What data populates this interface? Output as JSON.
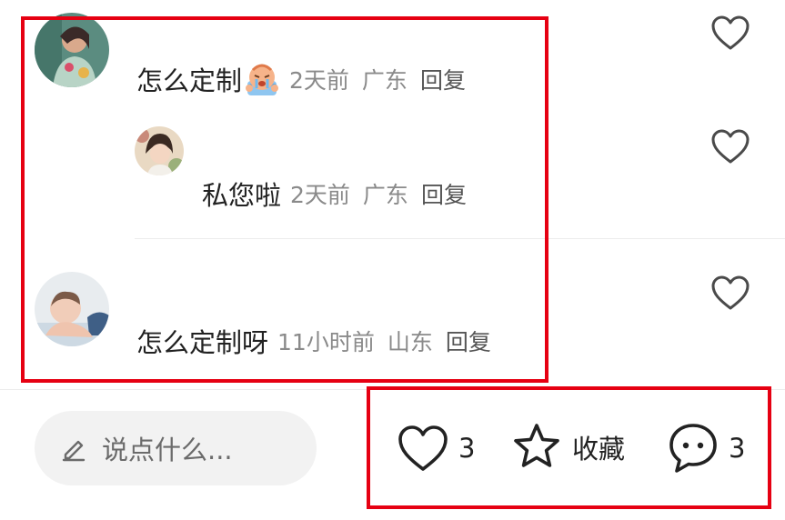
{
  "comments": [
    {
      "text": "怎么定制",
      "emoji": "crying-face-sticker",
      "time": "2天前",
      "location": "广东",
      "reply_label": "回复"
    },
    {
      "text": "私您啦",
      "time": "2天前",
      "location": "广东",
      "reply_label": "回复"
    },
    {
      "text": "怎么定制呀",
      "time": "11小时前",
      "location": "山东",
      "reply_label": "回复"
    }
  ],
  "bottom_bar": {
    "input_placeholder": "说点什么...",
    "like_count": "3",
    "collect_label": "收藏",
    "comment_count": "3"
  },
  "colors": {
    "highlight_border": "#e60012",
    "input_background": "#f2f2f2",
    "meta_text": "#8a8a8a"
  },
  "icons": [
    "heart-icon",
    "pencil-icon",
    "star-icon",
    "chat-bubble-icon"
  ]
}
